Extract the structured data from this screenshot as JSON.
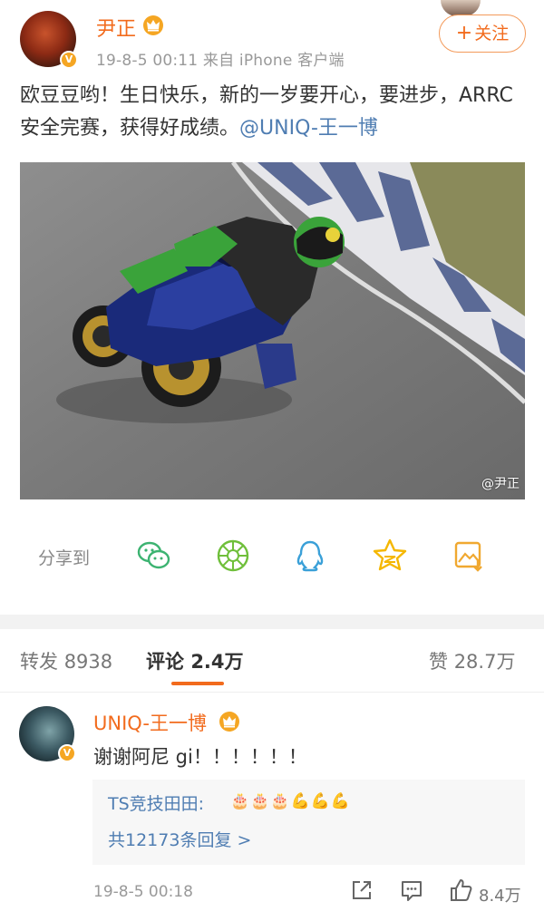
{
  "post": {
    "author": "尹正",
    "verified_badge": "V",
    "meta": "19-8-5 00:11  来自 iPhone 客户端",
    "follow_plus": "+",
    "follow_label": "关注",
    "text_main": "欧豆豆哟！生日快乐，新的一岁要开心，要进步，ARRC 安全完赛，获得好成绩。",
    "mention": "@UNIQ-王一博",
    "watermark": "@尹正"
  },
  "share": {
    "label": "分享到",
    "icons": [
      "wechat-icon",
      "moments-icon",
      "qq-icon",
      "qzone-icon",
      "save-image-icon"
    ]
  },
  "tabs": [
    {
      "label": "转发",
      "count": "8938"
    },
    {
      "label": "评论",
      "count": "2.4万"
    },
    {
      "label": "赞",
      "count": "28.7万"
    }
  ],
  "comment": {
    "author": "UNIQ-王一博",
    "text": "谢谢阿尼 gi！！！！！！",
    "reply_author": "TS竞技田田:",
    "reply_emoji": "🎂🎂🎂💪💪💪",
    "reply_more": "共12173条回复 >",
    "time": "19-8-5 00:18",
    "like_count": "8.4万"
  },
  "colors": {
    "accent": "#f26b1d",
    "link": "#4f7db2",
    "badge": "#f5a623"
  }
}
